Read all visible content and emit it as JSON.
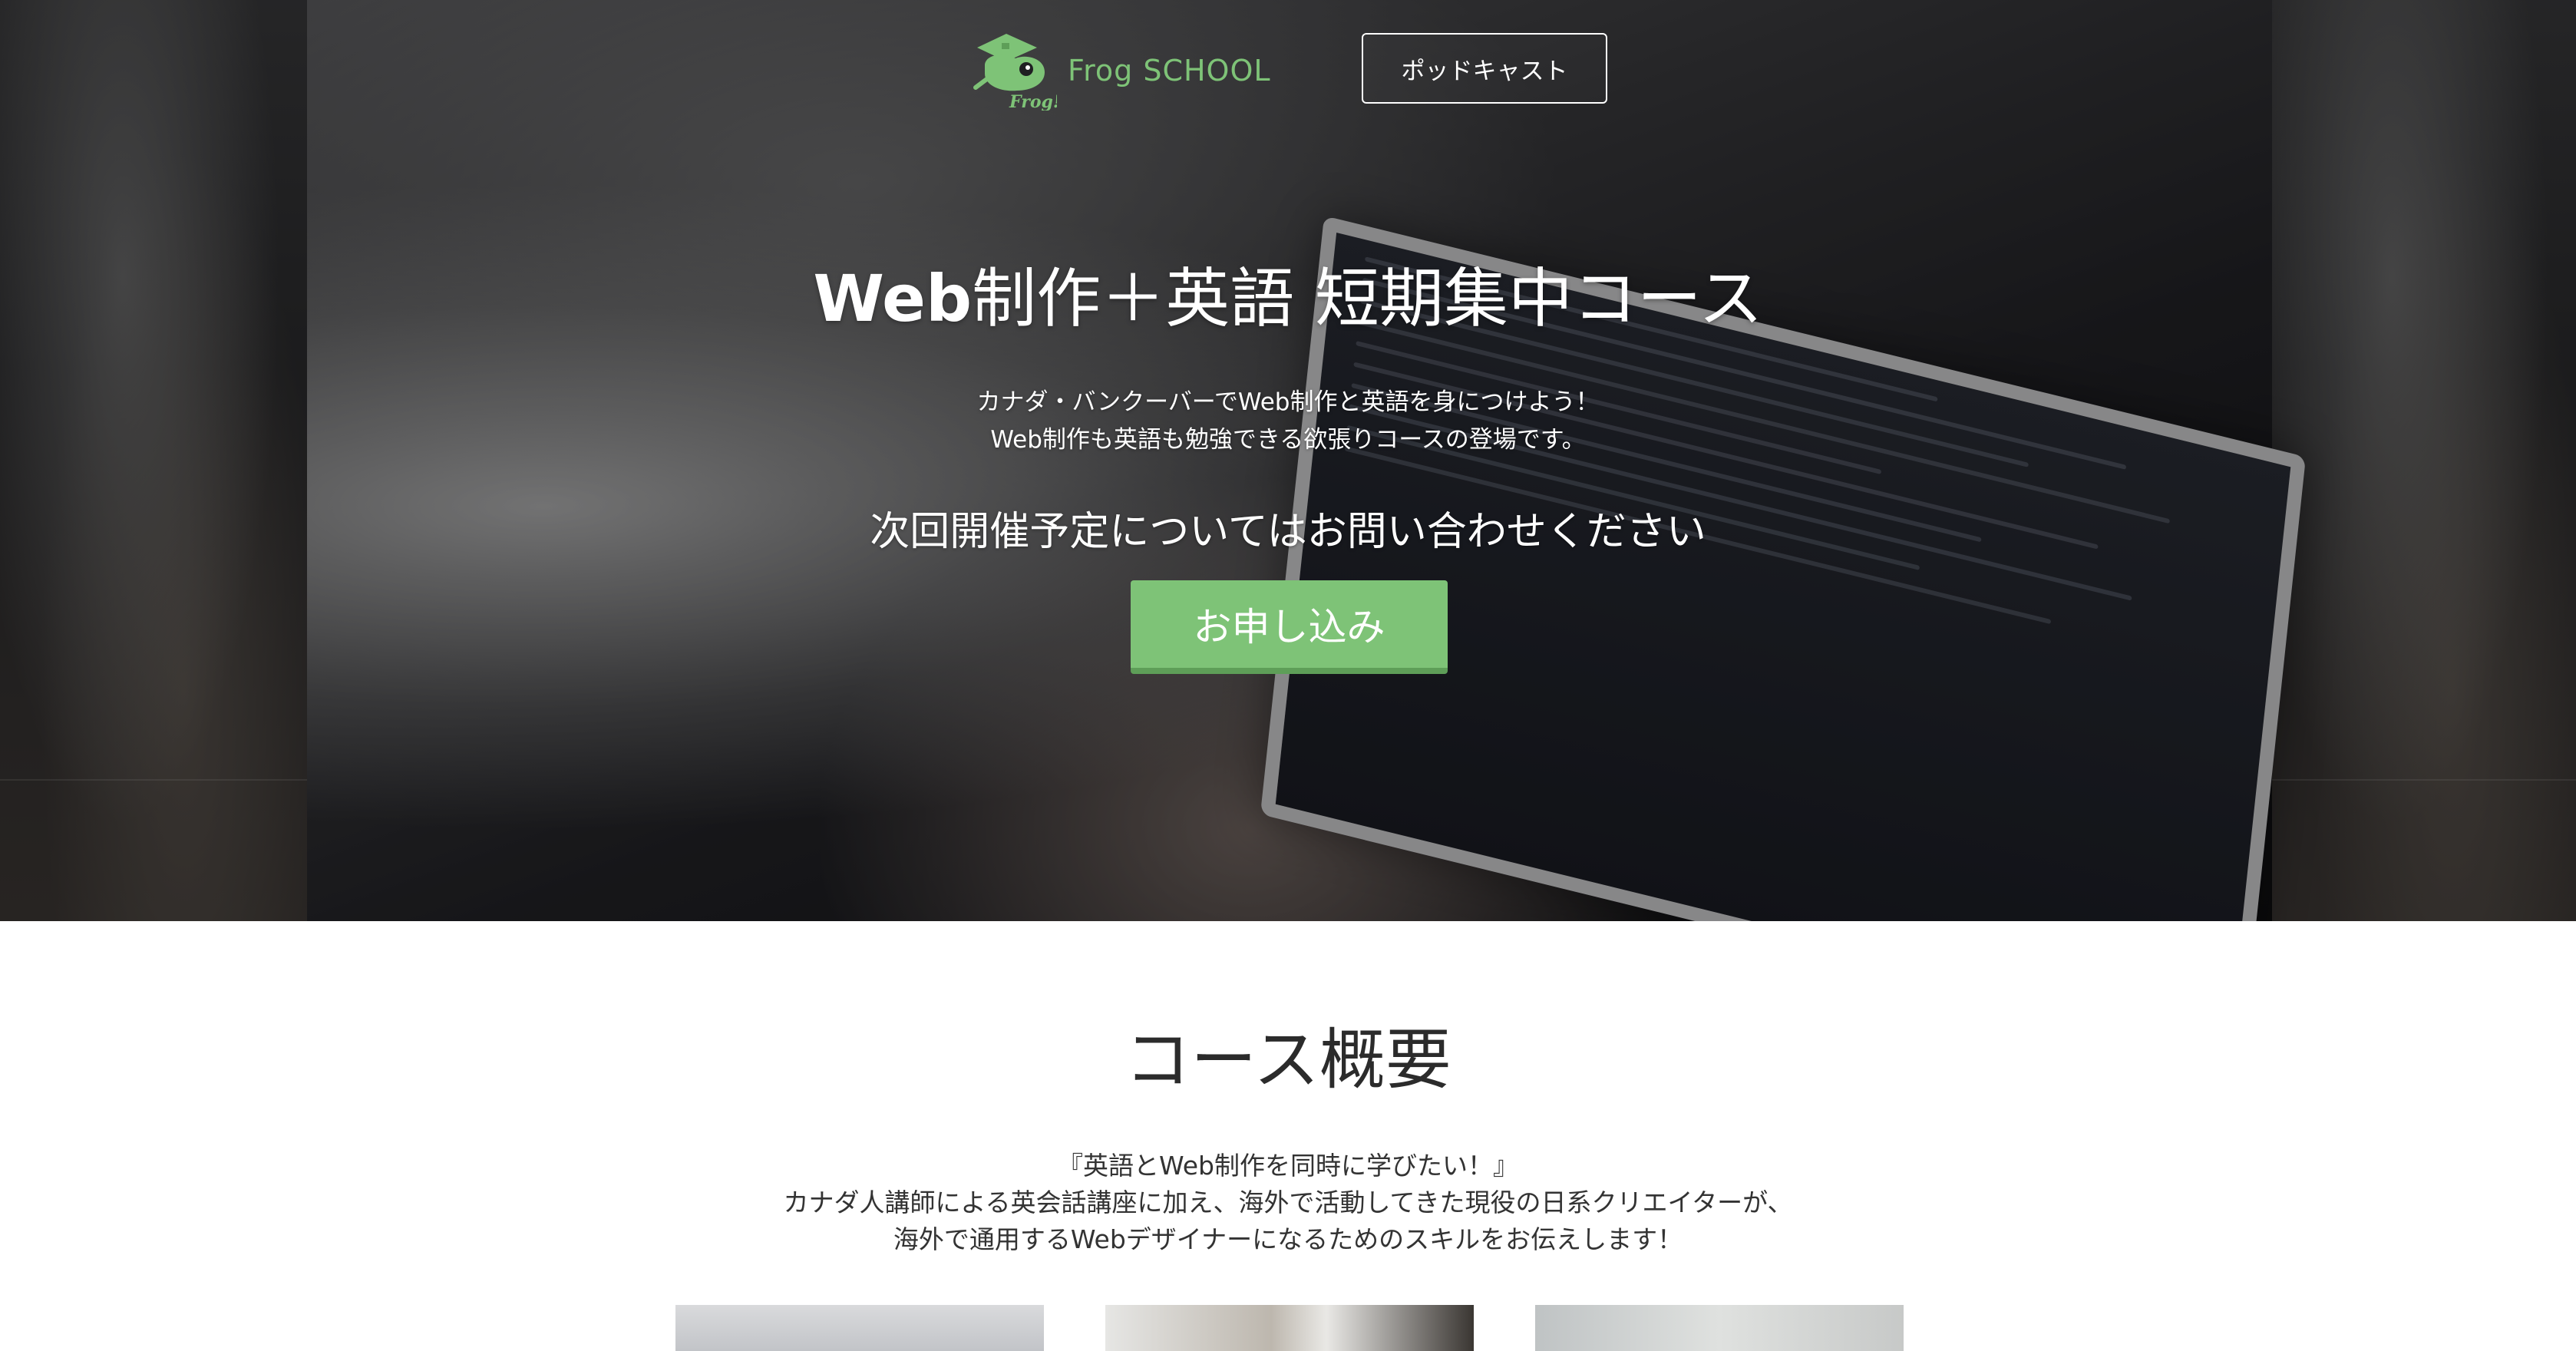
{
  "header": {
    "logo_text": "Frog SCHOOL",
    "logo_mark_text": "Frog!",
    "podcast_label": "ポッドキャスト"
  },
  "hero": {
    "title_bold": "Web",
    "title_rest": "制作＋英語 短期集中コース",
    "subtitle_lines": [
      "カナダ・バンクーバーでWeb制作と英語を身につけよう！",
      "Web制作も英語も勉強できる欲張りコースの登場です。"
    ],
    "notice": "次回開催予定についてはお問い合わせください",
    "apply_label": "お申し込み"
  },
  "overview": {
    "title": "コース概要",
    "lines": [
      "『英語とWeb制作を同時に学びたい！』",
      "カナダ人講師による英会話講座に加え、海外で活動してきた現役の日系クリエイターが、",
      "海外で通用するWebデザイナーになるためのスキルをお伝えします！"
    ]
  },
  "colors": {
    "brand_green": "#7ec377",
    "brand_green_dark": "#5e9e58",
    "heading_text": "#2b2b2b",
    "body_text": "#333333"
  },
  "icons": {
    "logo": "frog-with-graduation-cap-icon"
  }
}
